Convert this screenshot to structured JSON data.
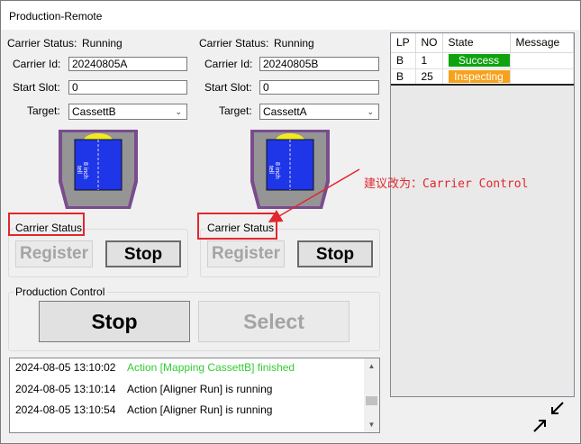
{
  "window": {
    "title": "Production-Remote"
  },
  "carrier_left": {
    "status_label": "Carrier Status:",
    "status_value": "Running",
    "id_label": "Carrier Id:",
    "id_value": "20240805A",
    "start_slot_label": "Start Slot:",
    "start_slot_value": "0",
    "target_label": "Target:",
    "target_value": "CassettB",
    "cassette_size_text": "8 inch",
    "cassette_side_text": "tell",
    "group_title": "Carrier Status",
    "register_label": "Register",
    "stop_label": "Stop"
  },
  "carrier_right": {
    "status_label": "Carrier Status:",
    "status_value": "Running",
    "id_label": "Carrier Id:",
    "id_value": "20240805B",
    "start_slot_label": "Start Slot:",
    "start_slot_value": "0",
    "target_label": "Target:",
    "target_value": "CassettA",
    "cassette_size_text": "8 inch",
    "cassette_side_text": "tell",
    "group_title": "Carrier Status",
    "register_label": "Register",
    "stop_label": "Stop"
  },
  "production_control": {
    "title": "Production Control",
    "stop_label": "Stop",
    "select_label": "Select"
  },
  "status_table": {
    "columns": [
      "LP",
      "NO",
      "State",
      "Message"
    ],
    "rows": [
      {
        "lp": "B",
        "no": "1",
        "state": "Success",
        "state_color": "#0fa30f",
        "message": ""
      },
      {
        "lp": "B",
        "no": "25",
        "state": "Inspecting",
        "state_color": "#f7a21b",
        "message": ""
      }
    ]
  },
  "log": {
    "entries": [
      {
        "time": "2024-08-05 13:10:02",
        "message": "Action [Mapping CassettB] finished",
        "color": "#33cc33"
      },
      {
        "time": "2024-08-05 13:10:14",
        "message": "Action [Aligner Run] is running",
        "color": "#000000"
      },
      {
        "time": "2024-08-05 13:10:54",
        "message": "Action [Aligner Run] is running",
        "color": "#000000"
      }
    ]
  },
  "annotation": {
    "text": "建议改为：Carrier Control",
    "color": "#e3262d"
  },
  "icons": {
    "dropdown": "chevron-down-icon",
    "scroll_up": "scroll-up-icon",
    "scroll_down": "scroll-down-icon",
    "resize": "collapse-arrows-icon"
  }
}
